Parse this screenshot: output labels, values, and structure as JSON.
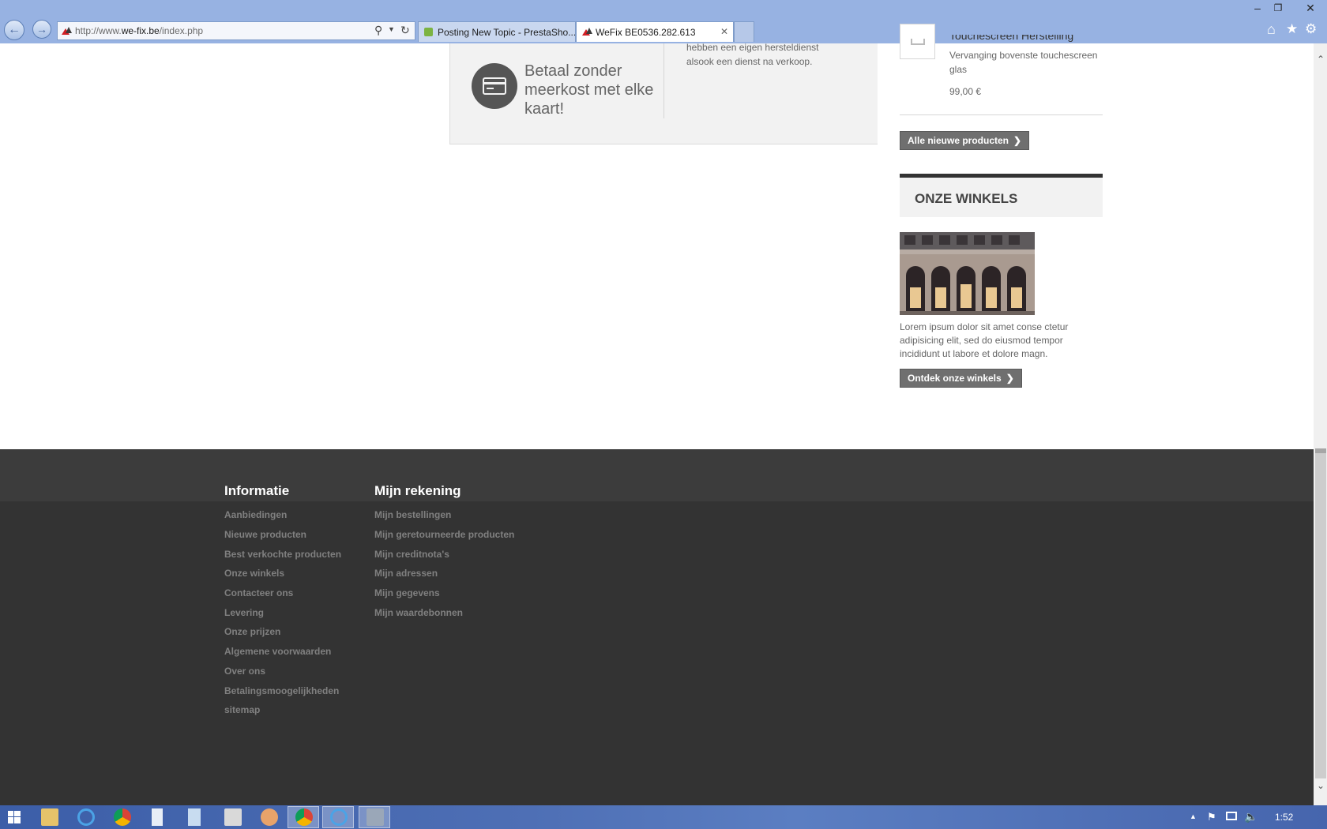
{
  "browser": {
    "url_prefix": "http://www.",
    "url_domain": "we-fix.be",
    "url_path": "/index.php",
    "tabs": [
      {
        "title": "Posting New Topic - PrestaSho..."
      },
      {
        "title": "WeFix BE0536.282.613"
      }
    ],
    "close_glyph": "✕"
  },
  "promo": {
    "pay_text": "Betaal zonder meerkost met elke kaart!",
    "service_text": "hebben een eigen hersteldienst alsook een dienst na verkoop."
  },
  "product": {
    "title": "Touchescreen Herstelling",
    "description": "Vervanging bovenste touchescreen glas",
    "price": "99,00 €"
  },
  "buttons": {
    "all_new_products": "Alle nieuwe producten",
    "discover_stores": "Ontdek onze winkels"
  },
  "stores": {
    "heading": "ONZE WINKELS",
    "text": "Lorem ipsum dolor sit amet conse ctetur adipisicing elit, sed do eiusmod tempor incididunt ut labore et dolore magn."
  },
  "footer": {
    "informatie": {
      "heading": "Informatie",
      "links": [
        "Aanbiedingen",
        "Nieuwe producten",
        "Best verkochte producten",
        "Onze winkels",
        "Contacteer ons",
        "Levering",
        "Onze prijzen",
        "Algemene voorwaarden",
        "Over ons",
        "Betalingsmoogelijkheden",
        "sitemap"
      ]
    },
    "rekening": {
      "heading": "Mijn rekening",
      "links": [
        "Mijn bestellingen",
        "Mijn geretourneerde producten",
        "Mijn creditnota's",
        "Mijn adressen",
        "Mijn gegevens",
        "Mijn waardebonnen"
      ]
    }
  },
  "taskbar": {
    "clock": "1:52"
  },
  "colors": {
    "footer_bg": "#333333",
    "button_bg": "#6f6f6f",
    "chrome_bg": "#97b2e2"
  }
}
